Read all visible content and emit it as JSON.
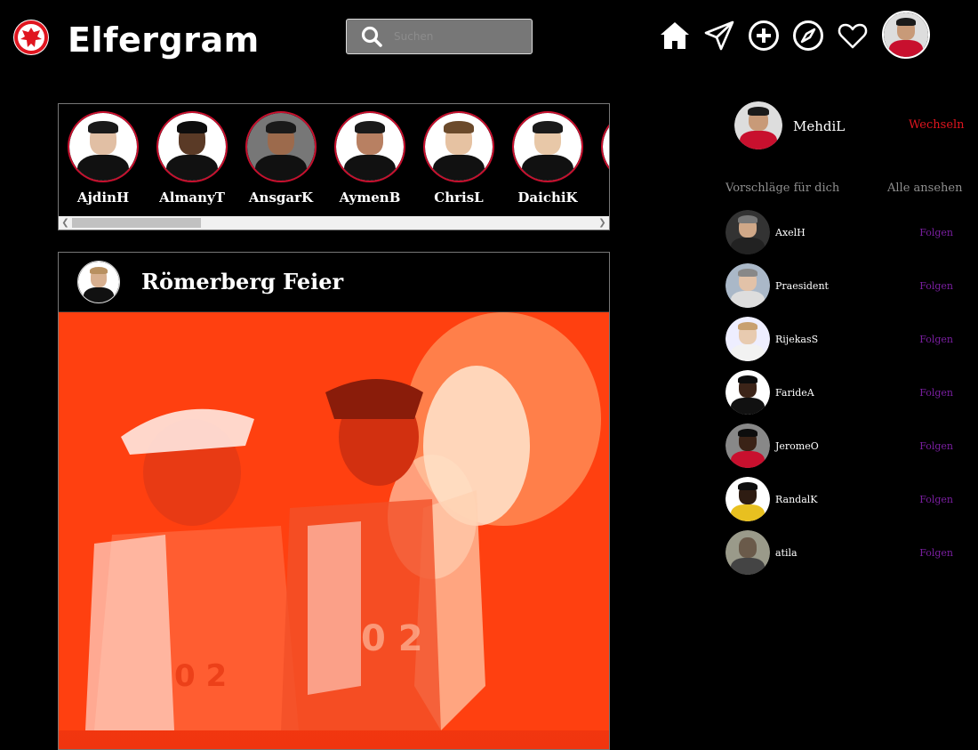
{
  "header": {
    "brand": "Elfergram",
    "search_placeholder": "Suchen",
    "icons": [
      "home-icon",
      "send-icon",
      "add-icon",
      "explore-icon",
      "heart-icon"
    ]
  },
  "colors": {
    "background": "#000000",
    "accent_red": "#e0151f",
    "follow_purple": "#7b1fa2",
    "story_ring": "#c8102e"
  },
  "stories": [
    {
      "name": "AjdinH"
    },
    {
      "name": "AlmanyT"
    },
    {
      "name": "AnsgarK"
    },
    {
      "name": "AymenB"
    },
    {
      "name": "ChrisL"
    },
    {
      "name": "DaichiK"
    }
  ],
  "post": {
    "title": "Römerberg Feier"
  },
  "sidebar": {
    "me": {
      "name": "MehdiL",
      "switch_label": "Wechseln"
    },
    "suggestions_title": "Vorschläge für dich",
    "see_all_label": "Alle ansehen",
    "follow_label": "Folgen",
    "suggestions": [
      {
        "name": "AxelH"
      },
      {
        "name": "Praesident"
      },
      {
        "name": "RijekasS"
      },
      {
        "name": "FarideA"
      },
      {
        "name": "JeromeO"
      },
      {
        "name": "RandalK"
      },
      {
        "name": "atila"
      }
    ]
  }
}
